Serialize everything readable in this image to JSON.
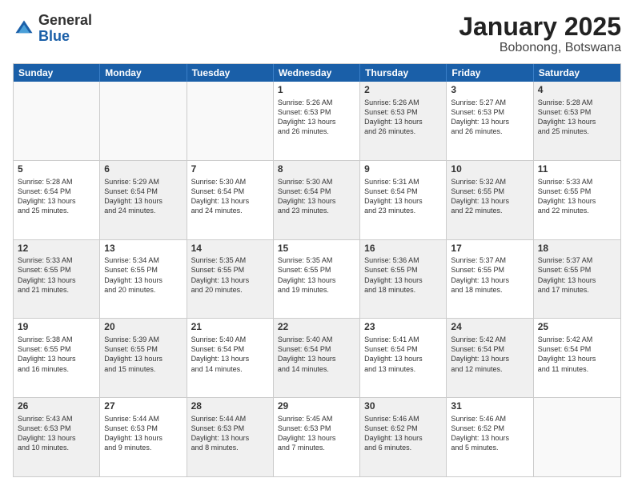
{
  "logo": {
    "general": "General",
    "blue": "Blue"
  },
  "header": {
    "month": "January 2025",
    "location": "Bobonong, Botswana"
  },
  "days": [
    "Sunday",
    "Monday",
    "Tuesday",
    "Wednesday",
    "Thursday",
    "Friday",
    "Saturday"
  ],
  "rows": [
    [
      {
        "day": "",
        "info": "",
        "shaded": false,
        "empty": true
      },
      {
        "day": "",
        "info": "",
        "shaded": false,
        "empty": true
      },
      {
        "day": "",
        "info": "",
        "shaded": false,
        "empty": true
      },
      {
        "day": "1",
        "info": "Sunrise: 5:26 AM\nSunset: 6:53 PM\nDaylight: 13 hours\nand 26 minutes.",
        "shaded": false,
        "empty": false
      },
      {
        "day": "2",
        "info": "Sunrise: 5:26 AM\nSunset: 6:53 PM\nDaylight: 13 hours\nand 26 minutes.",
        "shaded": true,
        "empty": false
      },
      {
        "day": "3",
        "info": "Sunrise: 5:27 AM\nSunset: 6:53 PM\nDaylight: 13 hours\nand 26 minutes.",
        "shaded": false,
        "empty": false
      },
      {
        "day": "4",
        "info": "Sunrise: 5:28 AM\nSunset: 6:53 PM\nDaylight: 13 hours\nand 25 minutes.",
        "shaded": true,
        "empty": false
      }
    ],
    [
      {
        "day": "5",
        "info": "Sunrise: 5:28 AM\nSunset: 6:54 PM\nDaylight: 13 hours\nand 25 minutes.",
        "shaded": false,
        "empty": false
      },
      {
        "day": "6",
        "info": "Sunrise: 5:29 AM\nSunset: 6:54 PM\nDaylight: 13 hours\nand 24 minutes.",
        "shaded": true,
        "empty": false
      },
      {
        "day": "7",
        "info": "Sunrise: 5:30 AM\nSunset: 6:54 PM\nDaylight: 13 hours\nand 24 minutes.",
        "shaded": false,
        "empty": false
      },
      {
        "day": "8",
        "info": "Sunrise: 5:30 AM\nSunset: 6:54 PM\nDaylight: 13 hours\nand 23 minutes.",
        "shaded": true,
        "empty": false
      },
      {
        "day": "9",
        "info": "Sunrise: 5:31 AM\nSunset: 6:54 PM\nDaylight: 13 hours\nand 23 minutes.",
        "shaded": false,
        "empty": false
      },
      {
        "day": "10",
        "info": "Sunrise: 5:32 AM\nSunset: 6:55 PM\nDaylight: 13 hours\nand 22 minutes.",
        "shaded": true,
        "empty": false
      },
      {
        "day": "11",
        "info": "Sunrise: 5:33 AM\nSunset: 6:55 PM\nDaylight: 13 hours\nand 22 minutes.",
        "shaded": false,
        "empty": false
      }
    ],
    [
      {
        "day": "12",
        "info": "Sunrise: 5:33 AM\nSunset: 6:55 PM\nDaylight: 13 hours\nand 21 minutes.",
        "shaded": true,
        "empty": false
      },
      {
        "day": "13",
        "info": "Sunrise: 5:34 AM\nSunset: 6:55 PM\nDaylight: 13 hours\nand 20 minutes.",
        "shaded": false,
        "empty": false
      },
      {
        "day": "14",
        "info": "Sunrise: 5:35 AM\nSunset: 6:55 PM\nDaylight: 13 hours\nand 20 minutes.",
        "shaded": true,
        "empty": false
      },
      {
        "day": "15",
        "info": "Sunrise: 5:35 AM\nSunset: 6:55 PM\nDaylight: 13 hours\nand 19 minutes.",
        "shaded": false,
        "empty": false
      },
      {
        "day": "16",
        "info": "Sunrise: 5:36 AM\nSunset: 6:55 PM\nDaylight: 13 hours\nand 18 minutes.",
        "shaded": true,
        "empty": false
      },
      {
        "day": "17",
        "info": "Sunrise: 5:37 AM\nSunset: 6:55 PM\nDaylight: 13 hours\nand 18 minutes.",
        "shaded": false,
        "empty": false
      },
      {
        "day": "18",
        "info": "Sunrise: 5:37 AM\nSunset: 6:55 PM\nDaylight: 13 hours\nand 17 minutes.",
        "shaded": true,
        "empty": false
      }
    ],
    [
      {
        "day": "19",
        "info": "Sunrise: 5:38 AM\nSunset: 6:55 PM\nDaylight: 13 hours\nand 16 minutes.",
        "shaded": false,
        "empty": false
      },
      {
        "day": "20",
        "info": "Sunrise: 5:39 AM\nSunset: 6:55 PM\nDaylight: 13 hours\nand 15 minutes.",
        "shaded": true,
        "empty": false
      },
      {
        "day": "21",
        "info": "Sunrise: 5:40 AM\nSunset: 6:54 PM\nDaylight: 13 hours\nand 14 minutes.",
        "shaded": false,
        "empty": false
      },
      {
        "day": "22",
        "info": "Sunrise: 5:40 AM\nSunset: 6:54 PM\nDaylight: 13 hours\nand 14 minutes.",
        "shaded": true,
        "empty": false
      },
      {
        "day": "23",
        "info": "Sunrise: 5:41 AM\nSunset: 6:54 PM\nDaylight: 13 hours\nand 13 minutes.",
        "shaded": false,
        "empty": false
      },
      {
        "day": "24",
        "info": "Sunrise: 5:42 AM\nSunset: 6:54 PM\nDaylight: 13 hours\nand 12 minutes.",
        "shaded": true,
        "empty": false
      },
      {
        "day": "25",
        "info": "Sunrise: 5:42 AM\nSunset: 6:54 PM\nDaylight: 13 hours\nand 11 minutes.",
        "shaded": false,
        "empty": false
      }
    ],
    [
      {
        "day": "26",
        "info": "Sunrise: 5:43 AM\nSunset: 6:53 PM\nDaylight: 13 hours\nand 10 minutes.",
        "shaded": true,
        "empty": false
      },
      {
        "day": "27",
        "info": "Sunrise: 5:44 AM\nSunset: 6:53 PM\nDaylight: 13 hours\nand 9 minutes.",
        "shaded": false,
        "empty": false
      },
      {
        "day": "28",
        "info": "Sunrise: 5:44 AM\nSunset: 6:53 PM\nDaylight: 13 hours\nand 8 minutes.",
        "shaded": true,
        "empty": false
      },
      {
        "day": "29",
        "info": "Sunrise: 5:45 AM\nSunset: 6:53 PM\nDaylight: 13 hours\nand 7 minutes.",
        "shaded": false,
        "empty": false
      },
      {
        "day": "30",
        "info": "Sunrise: 5:46 AM\nSunset: 6:52 PM\nDaylight: 13 hours\nand 6 minutes.",
        "shaded": true,
        "empty": false
      },
      {
        "day": "31",
        "info": "Sunrise: 5:46 AM\nSunset: 6:52 PM\nDaylight: 13 hours\nand 5 minutes.",
        "shaded": false,
        "empty": false
      },
      {
        "day": "",
        "info": "",
        "shaded": false,
        "empty": true
      }
    ]
  ]
}
